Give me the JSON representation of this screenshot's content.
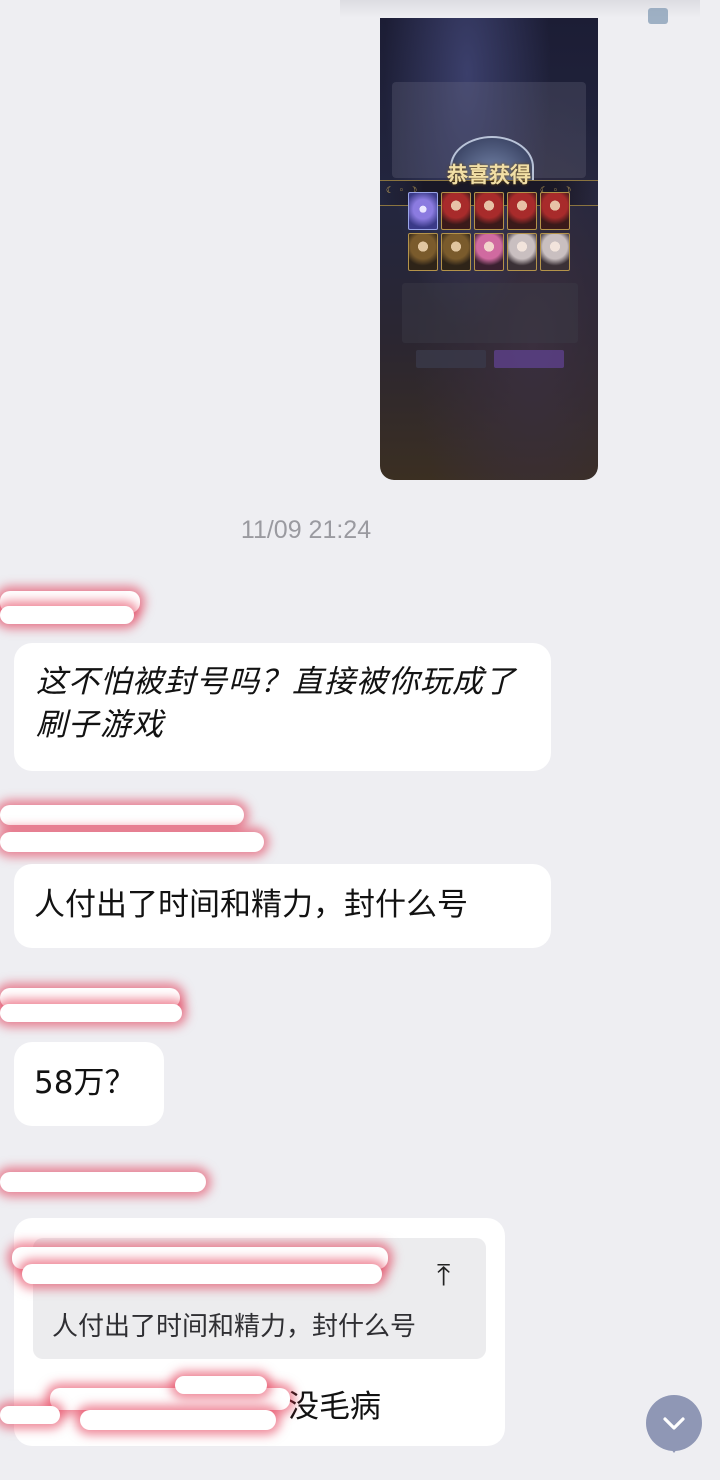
{
  "chat": {
    "timestamp": "11/09 21:24",
    "shared_image": {
      "banner_text": "恭喜获得",
      "moon_left": "☾ ◦ ☽",
      "moon_right": "☾ ◦ ☽"
    },
    "messages": [
      {
        "text": "这不怕被封号吗？直接被你玩成了刷子游戏"
      },
      {
        "text": "人付出了时间和精力，封什么号"
      },
      {
        "text": "58万？"
      },
      {
        "quote_text": "人付出了时间和精力，封什么号",
        "quote_icon": "⤒",
        "reply_visible_text": "没毛病"
      }
    ]
  },
  "scroll_button": {
    "icon": "chevron-down-icon",
    "glyph": "⌄"
  },
  "colors": {
    "background": "#eeeef2",
    "bubble": "#ffffff",
    "quote_bg": "#ececee",
    "scroll_button": "#8f97b5",
    "redaction_glow": "#e22c48"
  }
}
